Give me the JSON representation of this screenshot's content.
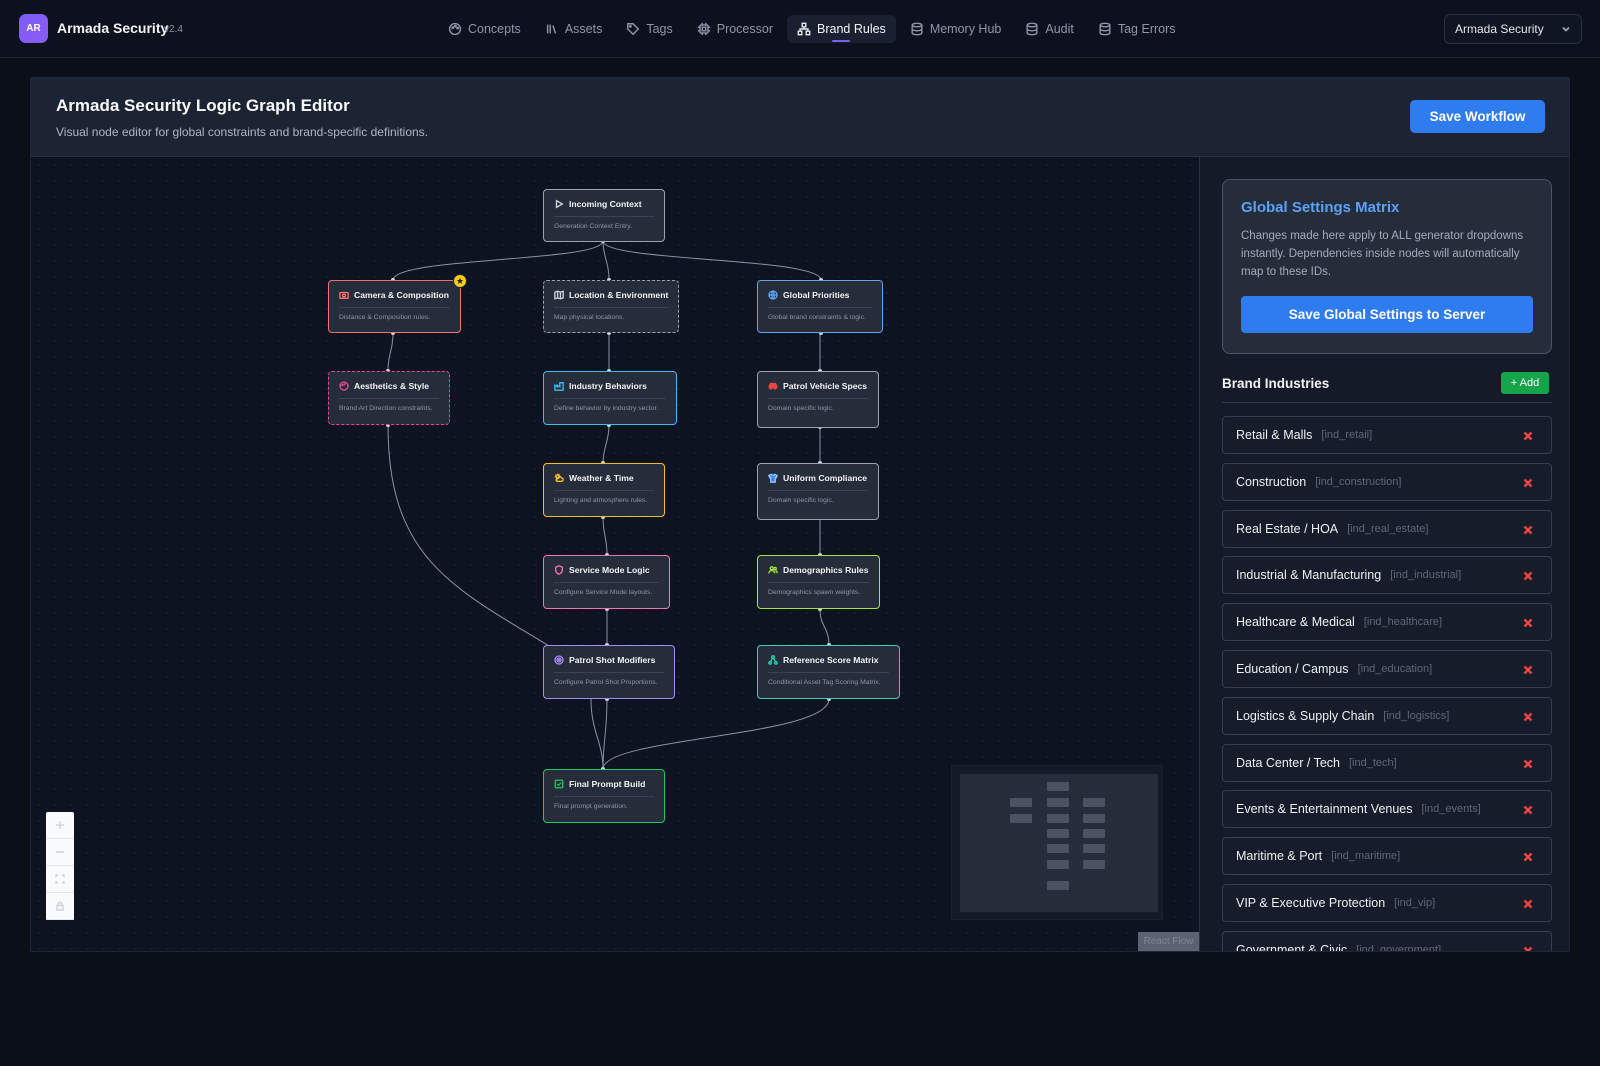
{
  "app": {
    "logo_initials": "AR",
    "name": "Armada Security",
    "version": "v2.4"
  },
  "nav": {
    "items": [
      {
        "label": "Concepts",
        "icon": "palette-icon",
        "active": false
      },
      {
        "label": "Assets",
        "icon": "library-icon",
        "active": false
      },
      {
        "label": "Tags",
        "icon": "tag-icon",
        "active": false
      },
      {
        "label": "Processor",
        "icon": "cpu-icon",
        "active": false
      },
      {
        "label": "Brand Rules",
        "icon": "workflow-icon",
        "active": true
      },
      {
        "label": "Memory Hub",
        "icon": "database-icon",
        "active": false
      },
      {
        "label": "Audit",
        "icon": "database-icon",
        "active": false
      },
      {
        "label": "Tag Errors",
        "icon": "database-icon",
        "active": false
      }
    ],
    "org_select": "Armada Security"
  },
  "header": {
    "title": "Armada Security Logic Graph Editor",
    "subtitle": "Visual node editor for global constraints and brand-specific definitions.",
    "save_label": "Save Workflow"
  },
  "graph": {
    "nodes": [
      {
        "id": "incoming",
        "title": "Incoming Context",
        "desc": "Generation Context Entry.",
        "icon": "play-icon",
        "accent": "#9ca3af"
      },
      {
        "id": "camera",
        "title": "Camera & Composition",
        "desc": "Distance & Composition rules.",
        "icon": "camera-icon",
        "accent": "#f87171"
      },
      {
        "id": "location",
        "title": "Location & Environment",
        "desc": "Map physical locations.",
        "icon": "map-icon",
        "accent": "#9ca3af"
      },
      {
        "id": "global",
        "title": "Global Priorities",
        "desc": "Global brand constraints & logic.",
        "icon": "globe-icon",
        "accent": "#60a5fa"
      },
      {
        "id": "aesthetics",
        "title": "Aesthetics & Style",
        "desc": "Brand Art Direction constraints.",
        "icon": "palette-icon",
        "accent": "#ec4899"
      },
      {
        "id": "industry",
        "title": "Industry Behaviors",
        "desc": "Define behavior by industry sector.",
        "icon": "factory-icon",
        "accent": "#38bdf8"
      },
      {
        "id": "patrol",
        "title": "Patrol Vehicle Specs",
        "desc": "Domain specific logic.",
        "icon": "car-icon",
        "accent": "#9ca3af"
      },
      {
        "id": "weather",
        "title": "Weather & Time",
        "desc": "Lighting and atmosphere rules.",
        "icon": "sun-cloud-icon",
        "accent": "#fbbf24"
      },
      {
        "id": "uniform",
        "title": "Uniform Compliance",
        "desc": "Domain specific logic.",
        "icon": "shirt-icon",
        "accent": "#9ca3af"
      },
      {
        "id": "service",
        "title": "Service Mode Logic",
        "desc": "Configure Service Mode layouts.",
        "icon": "shield-icon",
        "accent": "#f472b6"
      },
      {
        "id": "demographics",
        "title": "Demographics Rules",
        "desc": "Demographics spawn weights.",
        "icon": "users-icon",
        "accent": "#a3e635"
      },
      {
        "id": "patrolshot",
        "title": "Patrol Shot Modifiers",
        "desc": "Configure Patrol Shot Proportions.",
        "icon": "target-icon",
        "accent": "#a78bfa"
      },
      {
        "id": "reference",
        "title": "Reference Score Matrix",
        "desc": "Conditional Asset Tag Scoring Matrix.",
        "icon": "network-icon",
        "accent": "#2dd4bf"
      },
      {
        "id": "final",
        "title": "Final Prompt Build",
        "desc": "Final prompt generation.",
        "icon": "check-square-icon",
        "accent": "#22c55e"
      }
    ],
    "attribution": "React Flow"
  },
  "sidebar": {
    "global_settings": {
      "title": "Global Settings Matrix",
      "description": "Changes made here apply to ALL generator dropdowns instantly. Dependencies inside nodes will automatically map to these IDs.",
      "save_label": "Save Global Settings to Server"
    },
    "industries_title": "Brand Industries",
    "add_label": "+ Add",
    "industries": [
      {
        "name": "Retail & Malls",
        "id": "[ind_retail]"
      },
      {
        "name": "Construction",
        "id": "[ind_construction]"
      },
      {
        "name": "Real Estate / HOA",
        "id": "[ind_real_estate]"
      },
      {
        "name": "Industrial & Manufacturing",
        "id": "[ind_industrial]"
      },
      {
        "name": "Healthcare & Medical",
        "id": "[ind_healthcare]"
      },
      {
        "name": "Education / Campus",
        "id": "[ind_education]"
      },
      {
        "name": "Logistics & Supply Chain",
        "id": "[ind_logistics]"
      },
      {
        "name": "Data Center / Tech",
        "id": "[ind_tech]"
      },
      {
        "name": "Events & Entertainment Venues",
        "id": "[ind_events]"
      },
      {
        "name": "Maritime & Port",
        "id": "[ind_maritime]"
      },
      {
        "name": "VIP & Executive Protection",
        "id": "[ind_vip]"
      },
      {
        "name": "Government & Civic",
        "id": "[ind_government]"
      }
    ]
  }
}
